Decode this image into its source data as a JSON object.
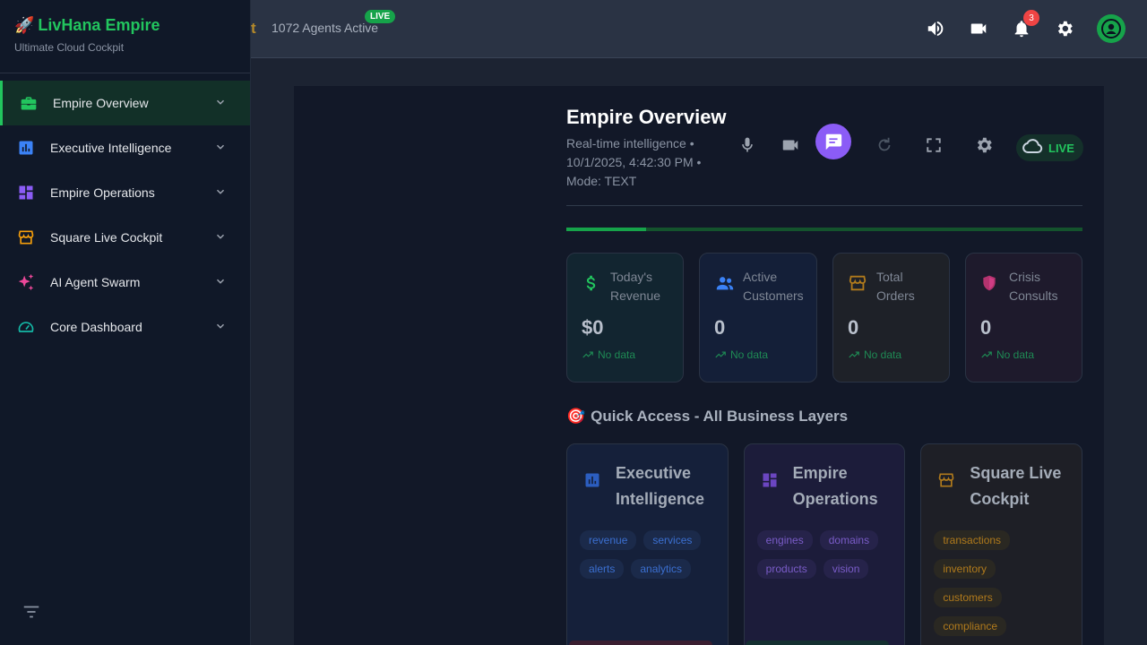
{
  "topbar": {
    "cut_text": "t",
    "agents_text": "1072 Agents Active",
    "live_label": "LIVE",
    "notification_count": "3",
    "icons": [
      "volume-icon",
      "video-icon",
      "bell-icon",
      "gear-icon",
      "avatar-icon"
    ]
  },
  "sidebar": {
    "brand": "LivHana Empire",
    "brand_emoji": "🚀",
    "subtitle": "Ultimate Cloud Cockpit",
    "items": [
      {
        "label": "Empire Overview",
        "icon": "briefcase-icon",
        "color": "#22c55e",
        "active": true
      },
      {
        "label": "Executive Intelligence",
        "icon": "bar-chart-icon",
        "color": "#3b82f6",
        "active": false
      },
      {
        "label": "Empire Operations",
        "icon": "dashboard-grid-icon",
        "color": "#8b5cf6",
        "active": false
      },
      {
        "label": "Square Live Cockpit",
        "icon": "storefront-icon",
        "color": "#f59e0b",
        "active": false
      },
      {
        "label": "AI Agent Swarm",
        "icon": "sparkle-icon",
        "color": "#ec4899",
        "active": false
      },
      {
        "label": "Core Dashboard",
        "icon": "speedometer-icon",
        "color": "#14b8a6",
        "active": false
      }
    ]
  },
  "header": {
    "title": "Empire Overview",
    "subtitle": "Real-time intelligence • 10/1/2025, 4:42:30 PM • Mode: TEXT",
    "live_label": "LIVE"
  },
  "progress": {
    "value": 0.155,
    "color": "#16a34a"
  },
  "stats": [
    {
      "label": "Today's Revenue",
      "value": "$0",
      "trend": "No data",
      "icon": "dollar-icon",
      "color": "#22c55e",
      "bg": "#122530"
    },
    {
      "label": "Active Customers",
      "value": "0",
      "trend": "No data",
      "icon": "people-icon",
      "color": "#3b82f6",
      "bg": "#141f38"
    },
    {
      "label": "Total Orders",
      "value": "0",
      "trend": "No data",
      "icon": "storefront-icon",
      "color": "#f59e0b",
      "bg": "#1e2128"
    },
    {
      "label": "Crisis Consults",
      "value": "0",
      "trend": "No data",
      "icon": "shield-icon",
      "color": "#ec4899",
      "bg": "#1e1a2c"
    }
  ],
  "quick_access": {
    "title": "Quick Access - All Business Layers",
    "emoji": "🎯",
    "cards": [
      {
        "title": "Executive Intelligence",
        "icon": "bar-chart-icon",
        "color": "#3b82f6",
        "bg": "#15203a",
        "tag_color": "#3b6fd0",
        "tag_bg": "#1b2a4a",
        "tags": [
          "revenue",
          "services",
          "alerts",
          "analytics"
        ]
      },
      {
        "title": "Empire Operations",
        "icon": "dashboard-grid-icon",
        "color": "#8b5cf6",
        "bg": "#1c1c3a",
        "tag_color": "#7a5cc8",
        "tag_bg": "#26234a",
        "tags": [
          "engines",
          "domains",
          "products",
          "vision"
        ]
      },
      {
        "title": "Square Live Cockpit",
        "icon": "storefront-icon",
        "color": "#f59e0b",
        "bg": "#1e1f26",
        "tag_color": "#b07a1c",
        "tag_bg": "#2a2822",
        "tags": [
          "transactions",
          "inventory",
          "customers",
          "compliance"
        ]
      }
    ]
  }
}
